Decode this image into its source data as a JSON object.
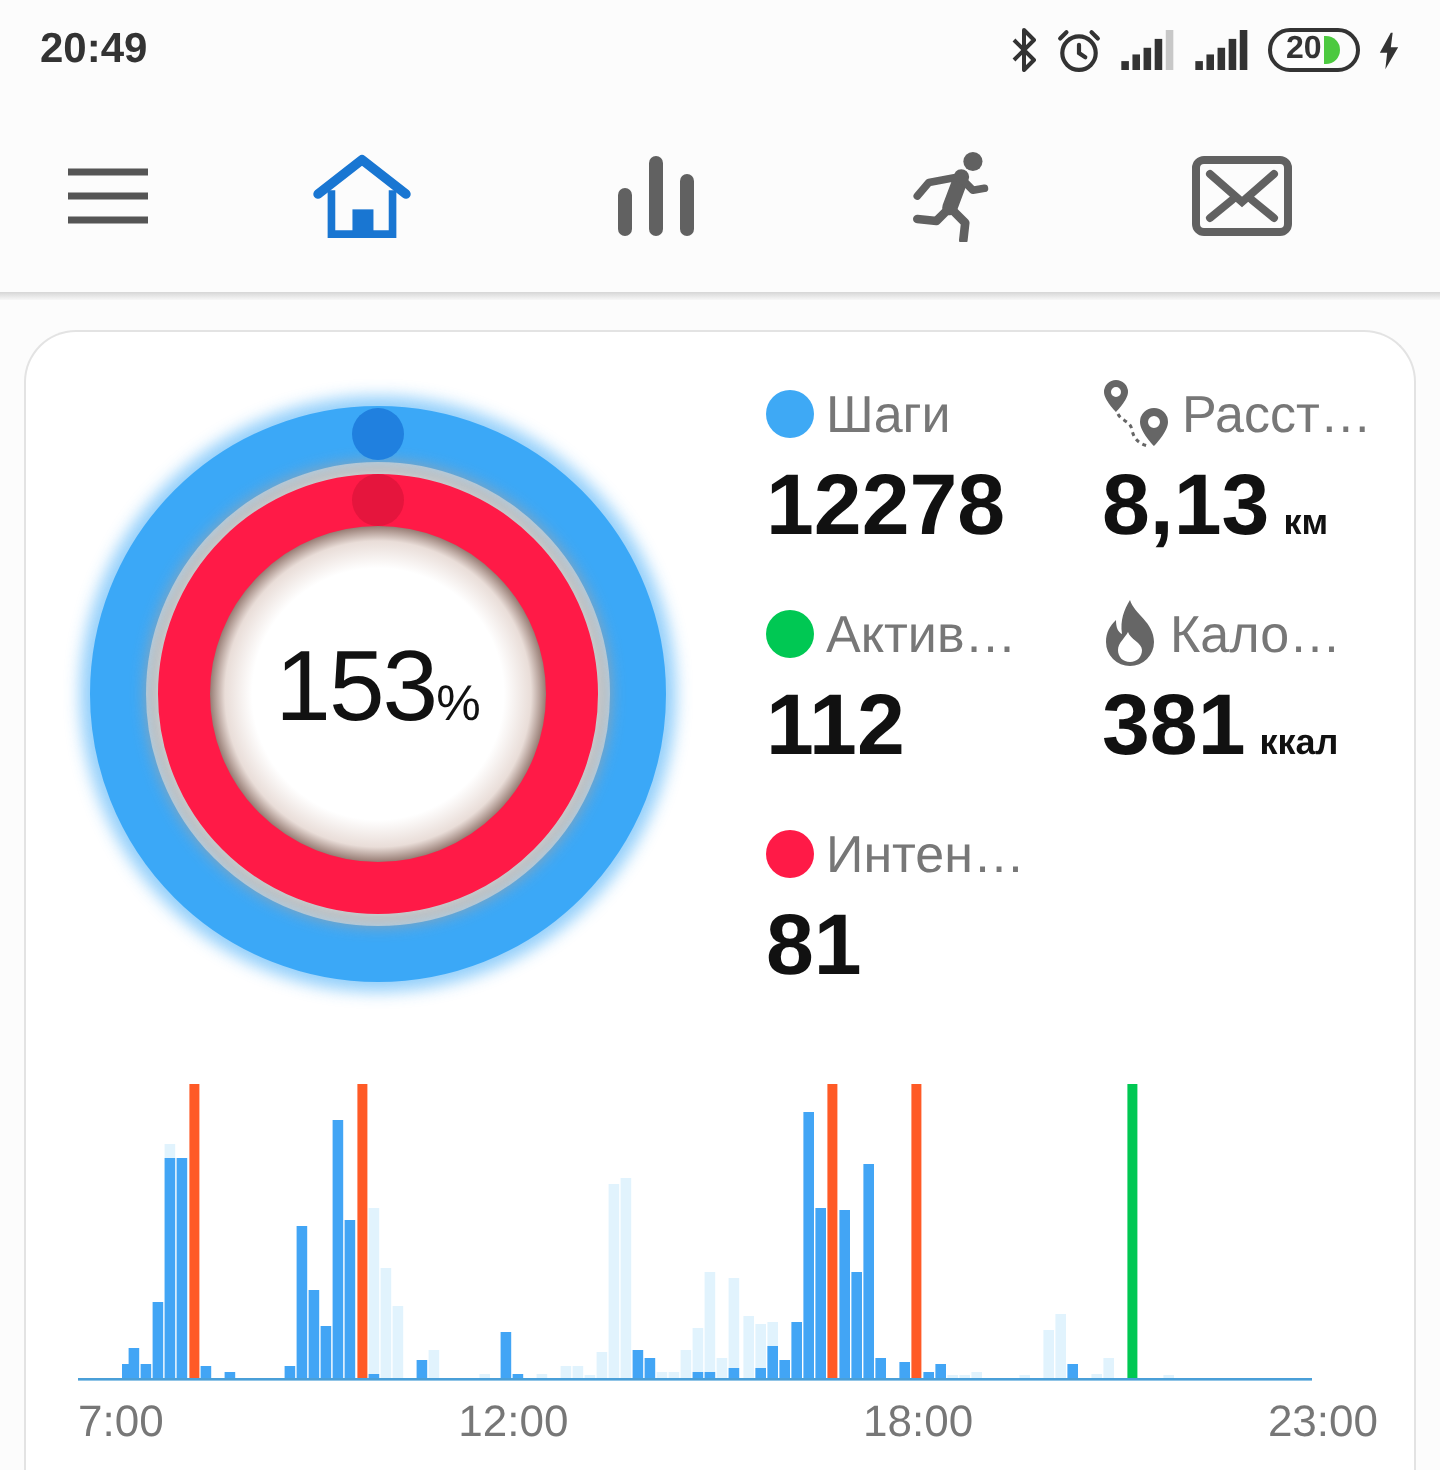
{
  "status_bar": {
    "time": "20:49",
    "battery": "20"
  },
  "tabs": [
    {
      "kind": "home",
      "selected": true
    },
    {
      "kind": "stats",
      "selected": false
    },
    {
      "kind": "workout",
      "selected": false
    },
    {
      "kind": "mail",
      "selected": false
    }
  ],
  "summary": {
    "percent": "153",
    "unit": "%",
    "rings": [
      {
        "color": "#3ba8f7",
        "level": 1
      },
      {
        "color": "#ff1a47",
        "level": 1
      }
    ]
  },
  "stats": [
    {
      "kind": "dot",
      "color": "#3ea9f5",
      "label": "Шаги",
      "value": "12278"
    },
    {
      "kind": "route",
      "label": "Расст…",
      "value": "8,13",
      "unit": "км"
    },
    {
      "kind": "dot",
      "color": "#00c853",
      "label": "Актив…",
      "value": "112"
    },
    {
      "kind": "flame",
      "label": "Кало…",
      "value": "381",
      "unit": "ккал"
    },
    {
      "kind": "dot",
      "color": "#ff1a47",
      "label": "Интен…",
      "value": "81"
    }
  ],
  "activity_chart": {
    "axis_labels": [
      "7:00",
      "12:00",
      "18:00",
      "23:00"
    ]
  }
}
